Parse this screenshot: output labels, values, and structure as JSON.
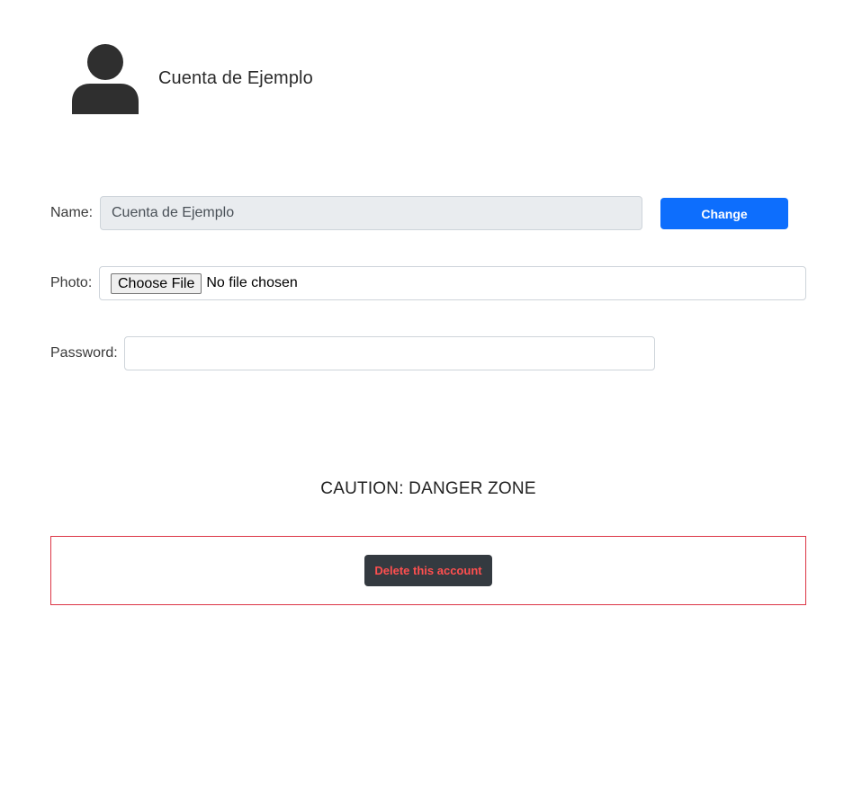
{
  "profile": {
    "avatar_icon": "user-silhouette-icon",
    "account_name": "Cuenta de Ejemplo"
  },
  "form": {
    "name": {
      "label": "Name:",
      "value": "Cuenta de Ejemplo",
      "change_label": "Change"
    },
    "photo": {
      "label": "Photo:",
      "choose_label": "Choose File",
      "status": "No file chosen"
    },
    "password": {
      "label": "Password:",
      "value": ""
    }
  },
  "danger_zone": {
    "title": "CAUTION: DANGER ZONE",
    "delete_label": "Delete this account"
  },
  "colors": {
    "primary": "#0d6efd",
    "danger": "#dc3545",
    "dark": "#343a40"
  }
}
